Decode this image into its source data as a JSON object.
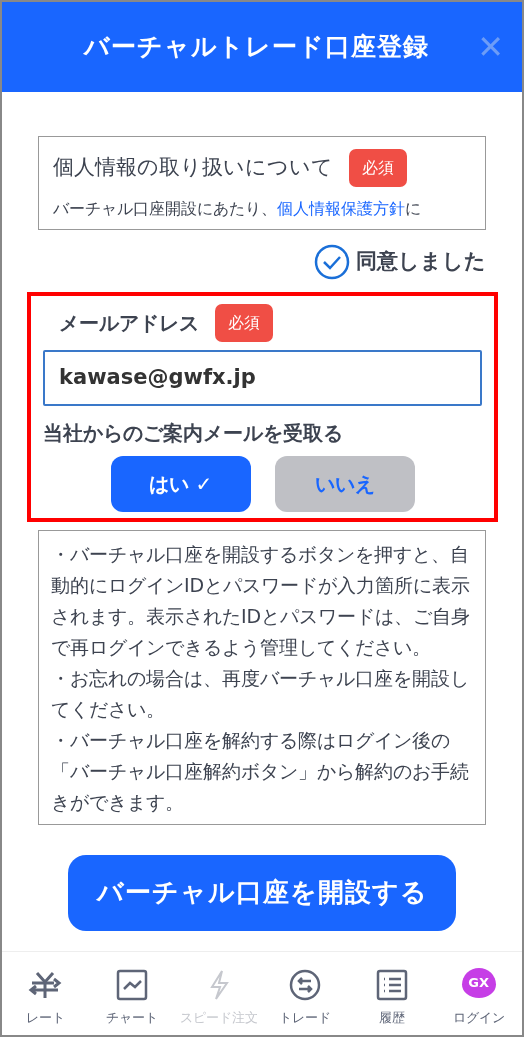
{
  "header": {
    "title": "バーチャルトレード口座登録",
    "close": "✕"
  },
  "privacy": {
    "title": "個人情報の取り扱いについて",
    "badge": "必須",
    "text_before": "バーチャル口座開設にあたり、",
    "link": "個人情報保護方針",
    "text_after": "に"
  },
  "agree": {
    "label": "同意しました",
    "checked": true
  },
  "email_section": {
    "highlighted": true,
    "label": "メールアドレス",
    "badge": "必須",
    "value": "kawase@gwfx.jp",
    "mail_label": "当社からのご案内メールを受取る",
    "options": [
      {
        "label": "はい ✓",
        "selected": true
      },
      {
        "label": "いいえ",
        "selected": false
      }
    ]
  },
  "notes": [
    "・バーチャル口座を開設するボタンを押すと、自動的にログインIDとパスワードが入力箇所に表示されます。表示されたIDとパスワードは、ご自身で再ログインできるよう管理してください。",
    "・お忘れの場合は、再度バーチャル口座を開設してください。",
    "・バーチャル口座を解約する際はログイン後の「バーチャル口座解約ボタン」から解約のお手続きができます。"
  ],
  "open_button": "バーチャル口座を開設する",
  "nav": [
    {
      "kind": "rate",
      "label": "レート",
      "disabled": false
    },
    {
      "kind": "chart",
      "label": "チャート",
      "disabled": false
    },
    {
      "kind": "speed",
      "label": "スピード注文",
      "disabled": true
    },
    {
      "kind": "trade",
      "label": "トレード",
      "disabled": false
    },
    {
      "kind": "history",
      "label": "履歴",
      "disabled": false
    },
    {
      "kind": "login",
      "label": "ログイン",
      "badge": "GX",
      "disabled": false
    }
  ]
}
